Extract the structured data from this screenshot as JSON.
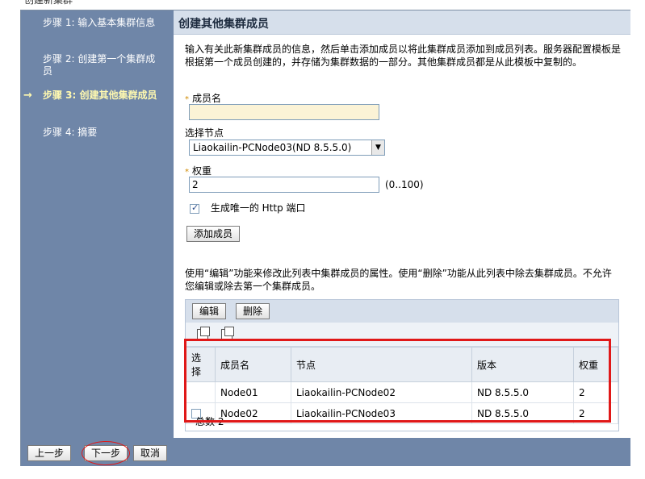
{
  "window": {
    "title": "创建新集群"
  },
  "sidebar": {
    "steps": [
      {
        "label": "步骤 1: 输入基本集群信息"
      },
      {
        "label": "步骤 2: 创建第一个集群成员"
      },
      {
        "label": "步骤 3: 创建其他集群成员",
        "active": true
      },
      {
        "label": "步骤 4: 摘要"
      }
    ],
    "active_marker": "→"
  },
  "main": {
    "title": "创建其他集群成员",
    "description": "输入有关此新集群成员的信息，然后单击添加成员以将此集群成员添加到成员列表。服务器配置模板是根据第一个成员创建的，并存储为集群数据的一部分。其他集群成员都是从此模板中复制的。",
    "required_marker": "*",
    "member_name": {
      "label": "成员名",
      "value": ""
    },
    "node": {
      "label": "选择节点",
      "selected": "Liaokailin-PCNode03(ND 8.5.5.0)"
    },
    "weight": {
      "label": "权重",
      "value": "2",
      "range": "(0..100)"
    },
    "http_port": {
      "label": "生成唯一的 Http 端口",
      "checked": true
    },
    "add_member_button": "添加成员",
    "table_hint": "使用“编辑”功能来修改此列表中集群成员的属性。使用“删除”功能从此列表中除去集群成员。不允许您编辑或除去第一个集群成员。",
    "edit_button": "编辑",
    "delete_button": "删除",
    "table": {
      "columns": [
        "选择",
        "成员名",
        "节点",
        "版本",
        "权重"
      ],
      "rows": [
        {
          "select": false,
          "has_checkbox": false,
          "name": "Node01",
          "node": "Liaokailin-PCNode02",
          "version": "ND 8.5.5.0",
          "weight": "2"
        },
        {
          "select": false,
          "has_checkbox": true,
          "name": "Node02",
          "node": "Liaokailin-PCNode03",
          "version": "ND 8.5.5.0",
          "weight": "2"
        }
      ],
      "total": "总数 2"
    }
  },
  "footer": {
    "prev_button": "上一步",
    "next_button": "下一步",
    "cancel_button": "取消"
  },
  "colors": {
    "sidebar_bg": "#6f86a8",
    "header_bg": "#d6dfeb",
    "active_step": "#fff9b0",
    "annotation_red": "#e01818"
  }
}
